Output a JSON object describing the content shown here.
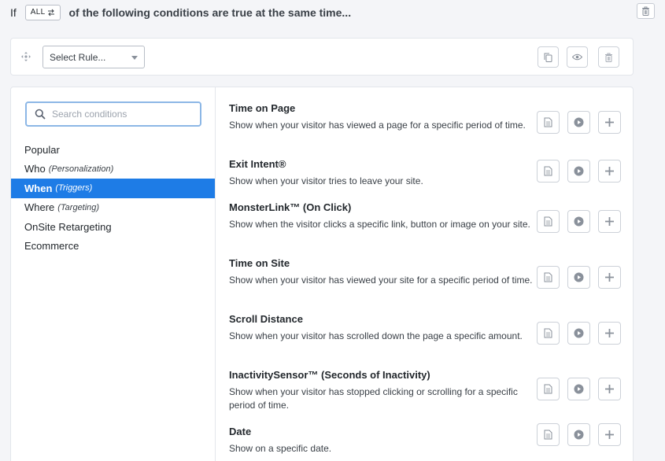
{
  "header": {
    "if_label": "If",
    "toggle_label": "ALL",
    "toggle_icon": "swap-arrows-icon",
    "conditions_text": "of the following conditions are true at the same time..."
  },
  "rule": {
    "select_placeholder": "Select Rule..."
  },
  "search": {
    "placeholder": "Search conditions"
  },
  "categories": [
    {
      "label": "Popular",
      "sub": ""
    },
    {
      "label": "Who",
      "sub": "(Personalization)"
    },
    {
      "label": "When",
      "sub": "(Triggers)",
      "active": true
    },
    {
      "label": "Where",
      "sub": "(Targeting)"
    },
    {
      "label": "OnSite Retargeting",
      "sub": ""
    },
    {
      "label": "Ecommerce",
      "sub": ""
    }
  ],
  "conditions": [
    {
      "title": "Time on Page",
      "desc": "Show when your visitor has viewed a page for a specific period of time."
    },
    {
      "title": "Exit Intent®",
      "desc": "Show when your visitor tries to leave your site."
    },
    {
      "title": "MonsterLink™ (On Click)",
      "desc": "Show when the visitor clicks a specific link, button or image on your site."
    },
    {
      "title": "Time on Site",
      "desc": "Show when your visitor has viewed your site for a specific period of time."
    },
    {
      "title": "Scroll Distance",
      "desc": "Show when your visitor has scrolled down the page a specific amount."
    },
    {
      "title": "InactivitySensor™ (Seconds of Inactivity)",
      "desc": "Show when your visitor has stopped clicking or scrolling for a specific period of time."
    },
    {
      "title": "Date",
      "desc": "Show on a specific date."
    }
  ],
  "colors": {
    "accent": "#1e7ce6",
    "icon": "#8a919b"
  }
}
